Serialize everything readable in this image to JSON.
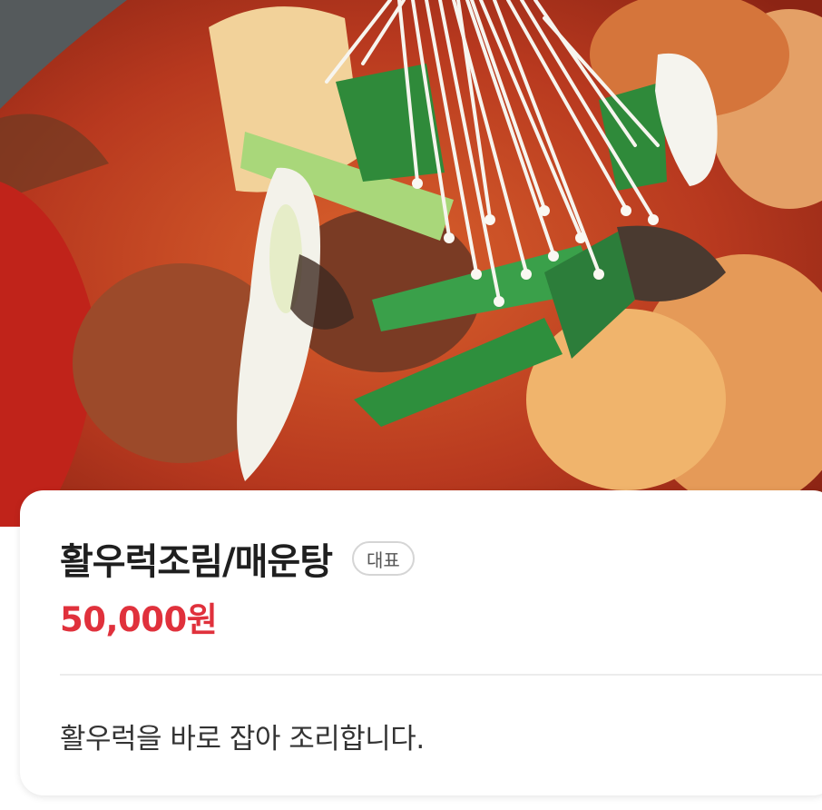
{
  "menu_item": {
    "name": "활우럭조림/매운탕",
    "badge": "대표",
    "price": "50,000원",
    "description": "활우럭을 바로 잡아 조리합니다."
  },
  "photo": {
    "subject": "spicy-rockfish-stew-photo"
  },
  "colors": {
    "price": "#e0313c",
    "title": "#1f1f1f",
    "badge_border": "#d5d5d5"
  }
}
